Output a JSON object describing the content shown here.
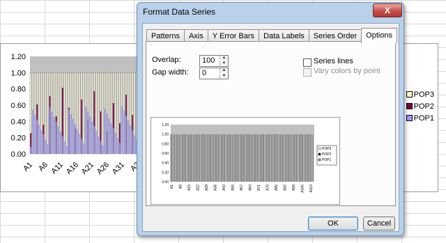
{
  "dialog": {
    "title": "Format Data Series",
    "close_label": "X",
    "tabs": [
      "Patterns",
      "Axis",
      "Y Error Bars",
      "Data Labels",
      "Series Order",
      "Options"
    ],
    "active_tab": "Options",
    "options": {
      "overlap_label": "Overlap:",
      "overlap_value": "100",
      "gap_width_label": "Gap width:",
      "gap_width_value": "0",
      "series_lines_label": "Series lines",
      "vary_colors_label": "Vary colors by point"
    },
    "ok_label": "OK",
    "cancel_label": "Cancel"
  },
  "background_chart": {
    "y_ticks": [
      "1.20",
      "1.00",
      "0.80",
      "0.60",
      "0.40",
      "0.20",
      "0.00"
    ],
    "x_ticks": [
      "A1",
      "A6",
      "A11",
      "A16",
      "A21",
      "A26",
      "A31",
      "A3"
    ],
    "legend": [
      {
        "label": "POP3",
        "color": "#ffffcc"
      },
      {
        "label": "POP2",
        "color": "#800040"
      },
      {
        "label": "POP1",
        "color": "#9999ff"
      }
    ]
  },
  "preview_chart": {
    "y_ticks": [
      "1.20",
      "1.00",
      "0.80",
      "0.60",
      "0.40",
      "0.20",
      "0.00"
    ],
    "x_ticks": [
      "A1",
      "A8",
      "A15",
      "A22",
      "A29",
      "A36",
      "A43",
      "A50",
      "A57",
      "A64",
      "A71",
      "A78",
      "A85",
      "A92",
      "A99",
      "A106",
      "A113"
    ],
    "legend": [
      "POP3",
      "POP2",
      "POP1"
    ]
  }
}
